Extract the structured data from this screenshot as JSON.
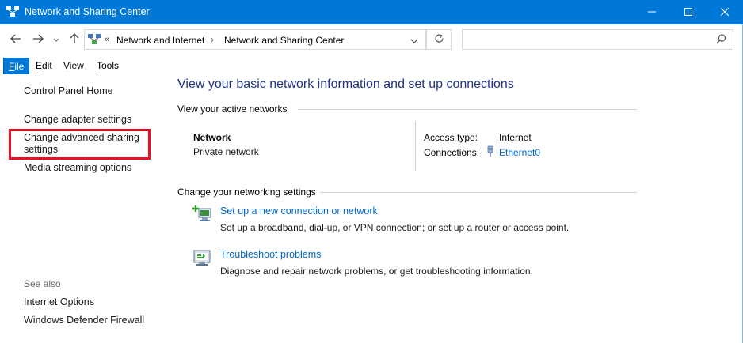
{
  "window": {
    "title": "Network and Sharing Center",
    "accent": "#0078d7",
    "icons": {
      "app": "network-center-icon",
      "min": "minimize-icon",
      "max": "maximize-icon",
      "close": "close-icon"
    }
  },
  "address": {
    "overflow": "«",
    "crumbs": [
      "Network and Internet",
      "Network and Sharing Center"
    ],
    "separator": "›",
    "search_placeholder": ""
  },
  "menu": {
    "items": [
      {
        "key": "F",
        "rest": "ile"
      },
      {
        "key": "E",
        "rest": "dit"
      },
      {
        "key": "V",
        "rest": "iew"
      },
      {
        "key": "T",
        "rest": "ools"
      }
    ]
  },
  "sidebar": {
    "home": "Control Panel Home",
    "adapter": "Change adapter settings",
    "advanced": "Change advanced sharing settings",
    "media": "Media streaming options",
    "see_also": "See also",
    "internet_options": "Internet Options",
    "firewall": "Windows Defender Firewall",
    "highlight_color": "#e81123"
  },
  "main": {
    "title": "View your basic network information and set up connections",
    "active_networks_heading": "View your active networks",
    "network": {
      "name": "Network",
      "category": "Private network",
      "access_label": "Access type:",
      "access_value": "Internet",
      "connections_label": "Connections:",
      "connection_name": "Ethernet0"
    },
    "change_heading": "Change your networking settings",
    "tasks": [
      {
        "link": "Set up a new connection or network",
        "desc": "Set up a broadband, dial-up, or VPN connection; or set up a router or access point."
      },
      {
        "link": "Troubleshoot problems",
        "desc": "Diagnose and repair network problems, or get troubleshooting information."
      }
    ]
  }
}
